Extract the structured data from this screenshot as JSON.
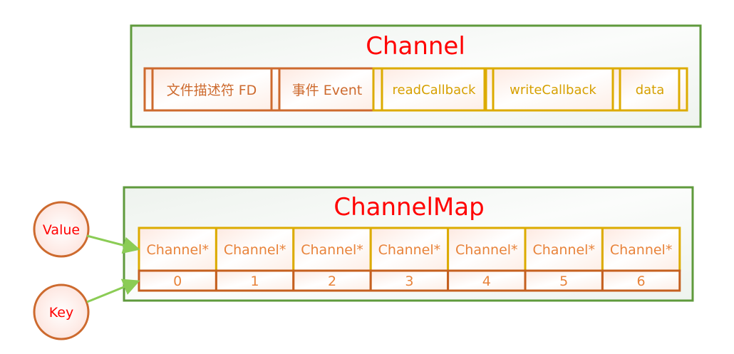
{
  "channel": {
    "title": "Channel",
    "fields": [
      "文件描述符 FD",
      "事件 Event",
      "readCallback",
      "writeCallback",
      "data"
    ]
  },
  "channel_map": {
    "title": "ChannelMap",
    "values": [
      "Channel*",
      "Channel*",
      "Channel*",
      "Channel*",
      "Channel*",
      "Channel*",
      "Channel*"
    ],
    "keys": [
      "0",
      "1",
      "2",
      "3",
      "4",
      "5",
      "6"
    ]
  },
  "legend": {
    "value_label": "Value",
    "key_label": "Key"
  },
  "colors": {
    "container_border": "#5f9a3c",
    "orange": "#cd6a2e",
    "yellow": "#dcab00",
    "title": "#ff0000",
    "arrow": "#8bcc55"
  }
}
